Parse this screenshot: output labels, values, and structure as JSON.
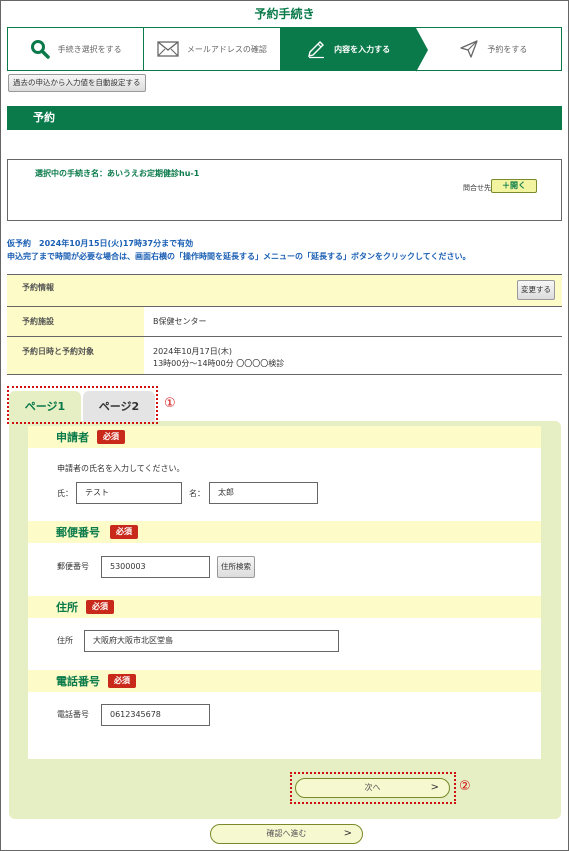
{
  "page_title": "予約手続き",
  "steps": [
    {
      "label": "手続き選択をする",
      "icon": "search-icon"
    },
    {
      "label": "メールアドレスの確認",
      "icon": "mail-icon"
    },
    {
      "label": "内容を入力する",
      "icon": "pencil-icon"
    },
    {
      "label": "予約をする",
      "icon": "send-icon"
    }
  ],
  "auto_fill_button": "過去の申込から入力値を自動設定する",
  "section_title": "予約",
  "procedure": {
    "label": "選択中の手続き名：",
    "name": "あいうえお定期健診hu-1",
    "contact_label": "問合せ先",
    "open_button": "＋開く"
  },
  "notice": {
    "line1": "仮予約　2024年10月15日(火)17時37分まで有効",
    "line2": "申込完了まで時間が必要な場合は、画面右横の「操作時間を延長する」メニューの「延長する」ボタンをクリックしてください。"
  },
  "reservation": {
    "header": "予約情報",
    "change_button": "変更する",
    "facility_label": "予約施設",
    "facility_value": "B保健センター",
    "datetime_label": "予約日時と予約対象",
    "datetime_line1": "2024年10月17日(木)",
    "datetime_line2": "13時00分～14時00分 〇〇〇〇検診"
  },
  "tabs": {
    "page1": "ページ1",
    "page2": "ページ2"
  },
  "markers": {
    "one": "①",
    "two": "②"
  },
  "required_badge": "必須",
  "applicant": {
    "title": "申請者",
    "description": "申請者の氏名を入力してください。",
    "last_label": "氏：",
    "last_value": "テスト",
    "first_label": "名：",
    "first_value": "太郎"
  },
  "postal": {
    "title": "郵便番号",
    "label": "郵便番号",
    "value": "5300003",
    "search_button": "住所検索"
  },
  "address": {
    "title": "住所",
    "label": "住所",
    "value": "大阪府大阪市北区堂島"
  },
  "phone": {
    "title": "電話番号",
    "label": "電話番号",
    "value": "0612345678"
  },
  "next_button": "次へ",
  "confirm_button": "確認へ進む",
  "arrow": ">"
}
